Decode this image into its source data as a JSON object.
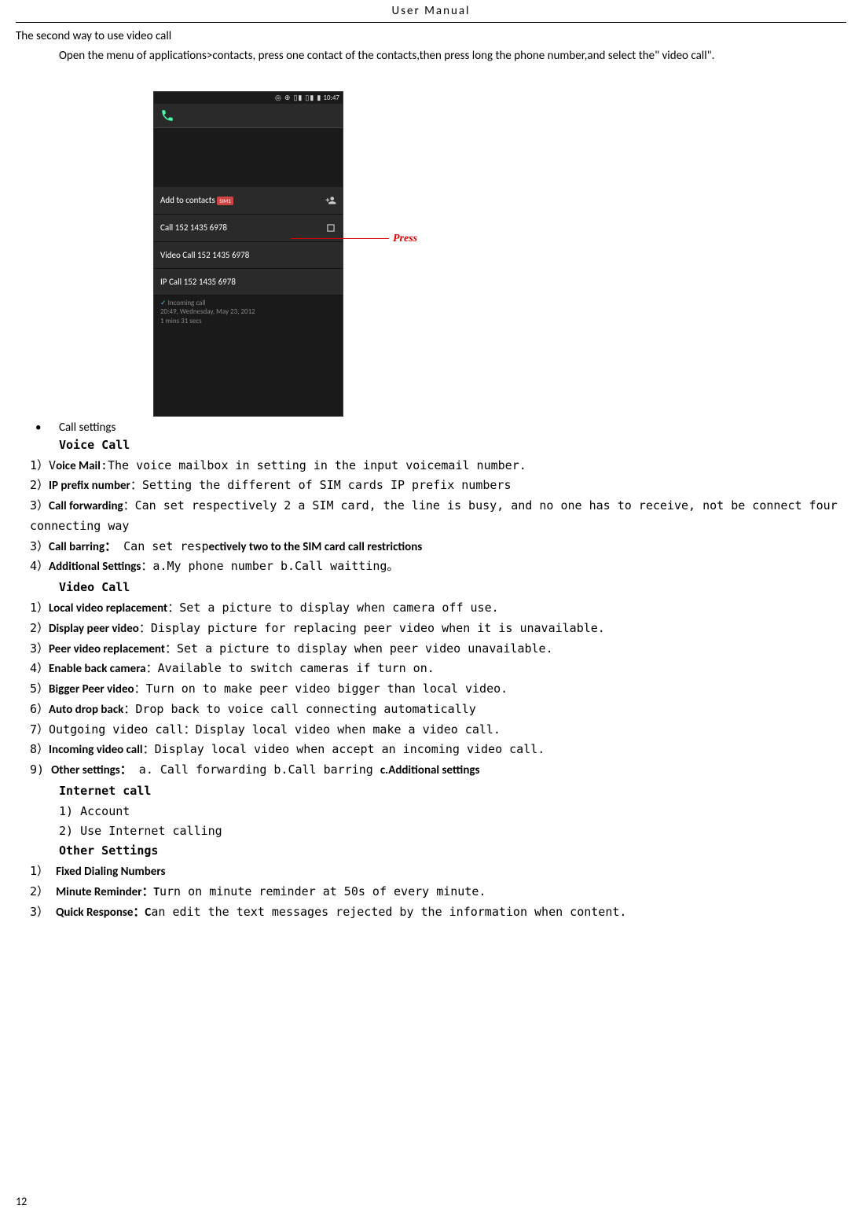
{
  "header": {
    "title": "User    Manual"
  },
  "intro": {
    "heading": "The second way to use video call",
    "paragraph": "Open  the  menu  of  applications>contacts,  press    one  contact  of  the  contacts,then  press  long  the  phone number,and select the\" video call\"."
  },
  "screenshot": {
    "status_time": "10:47",
    "status_icons": "◎ ⊕ ▯▮ ▯▮ ▮",
    "add_to_contacts": "Add to contacts",
    "sim_badge": "SIM1",
    "call_row": "Call 152 1435 6978",
    "video_call_row": "Video Call 152 1435 6978",
    "ip_call_row": "IP Call 152 1435 6978",
    "incoming_label": "Incoming call",
    "incoming_time": "20:49, Wednesday, May 23, 2012",
    "incoming_duration": "1 mins 31 secs",
    "press_annotation": "Press"
  },
  "call_settings": {
    "bullet_label": "Call settings",
    "voice_call": {
      "heading": "Voice Call",
      "item1_prefix": "1）V",
      "item1_bold": "oice Mail",
      "item1_text": ":The voice mailbox in setting in the input voicemail number.",
      "item2_prefix": "2）",
      "item2_bold": "IP prefix number",
      "item2_text": "：Setting the different of SIM cards IP prefix numbers",
      "item3_prefix": "3）",
      "item3_bold": "Call forwarding",
      "item3_text": "：Can set respectively 2 a SIM card, the line is busy, and no one has to receive, not be connect four connecting way",
      "item4_prefix": "3）",
      "item4_bold": "Call barring：",
      "item4_text": " Can set resp",
      "item4_bold2": "ectively two to the SIM card call restrictions",
      "item5_prefix": "4）",
      "item5_bold": "Additional Settings",
      "item5_text": "：a.My phone number b.Call waitting。"
    },
    "video_call": {
      "heading": "Video Call",
      "item1_prefix": "1）",
      "item1_bold": "Local video replacement",
      "item1_text": "：Set a picture to display when camera off use.",
      "item2_prefix": "2）",
      "item2_bold": "Display peer video",
      "item2_text": "：Display picture for replacing peer video when it is unavailable.",
      "item3_prefix": "3）",
      "item3_bold": "Peer video replacement",
      "item3_text": "：Set a picture to display when peer video unavailable.",
      "item4_prefix": "4）",
      "item4_bold": "Enable back camera",
      "item4_text": "：Available to switch cameras if turn on.",
      "item5_prefix": "5）",
      "item5_bold": "Bigger Peer video",
      "item5_text": "：Turn on to make peer video bigger than local video.",
      "item6_prefix": "6）",
      "item6_bold": "Auto drop back",
      "item6_text": "：Drop back to voice call connecting automatically",
      "item7_prefix": "7）",
      "item7_text": "Outgoing video call：Display local video when make a video call.",
      "item8_prefix": "8）",
      "item8_bold": "Incoming video call",
      "item8_text": "：Display local video when accept an incoming video call.",
      "item9_prefix": "9) ",
      "item9_bold": "Other settings：",
      "item9_text": "  a. Call forwarding  b.Call barring  ",
      "item9_bold2": "c.Additional settings"
    },
    "internet_call": {
      "heading": "Internet call",
      "item1": "1)  Account",
      "item2": "2)  Use Internet calling"
    },
    "other_settings": {
      "heading": "Other Settings",
      "item1_prefix": "1） ",
      "item1_bold": "Fixed Dialing Numbers",
      "item2_prefix": "2） ",
      "item2_bold": "Minute Reminder：T",
      "item2_text": "urn on minute reminder at 50s of every minute.",
      "item3_prefix": "3） ",
      "item3_bold": "Quick Response：C",
      "item3_text": "an edit the text messages rejected by the information when content."
    }
  },
  "page_number": "12"
}
